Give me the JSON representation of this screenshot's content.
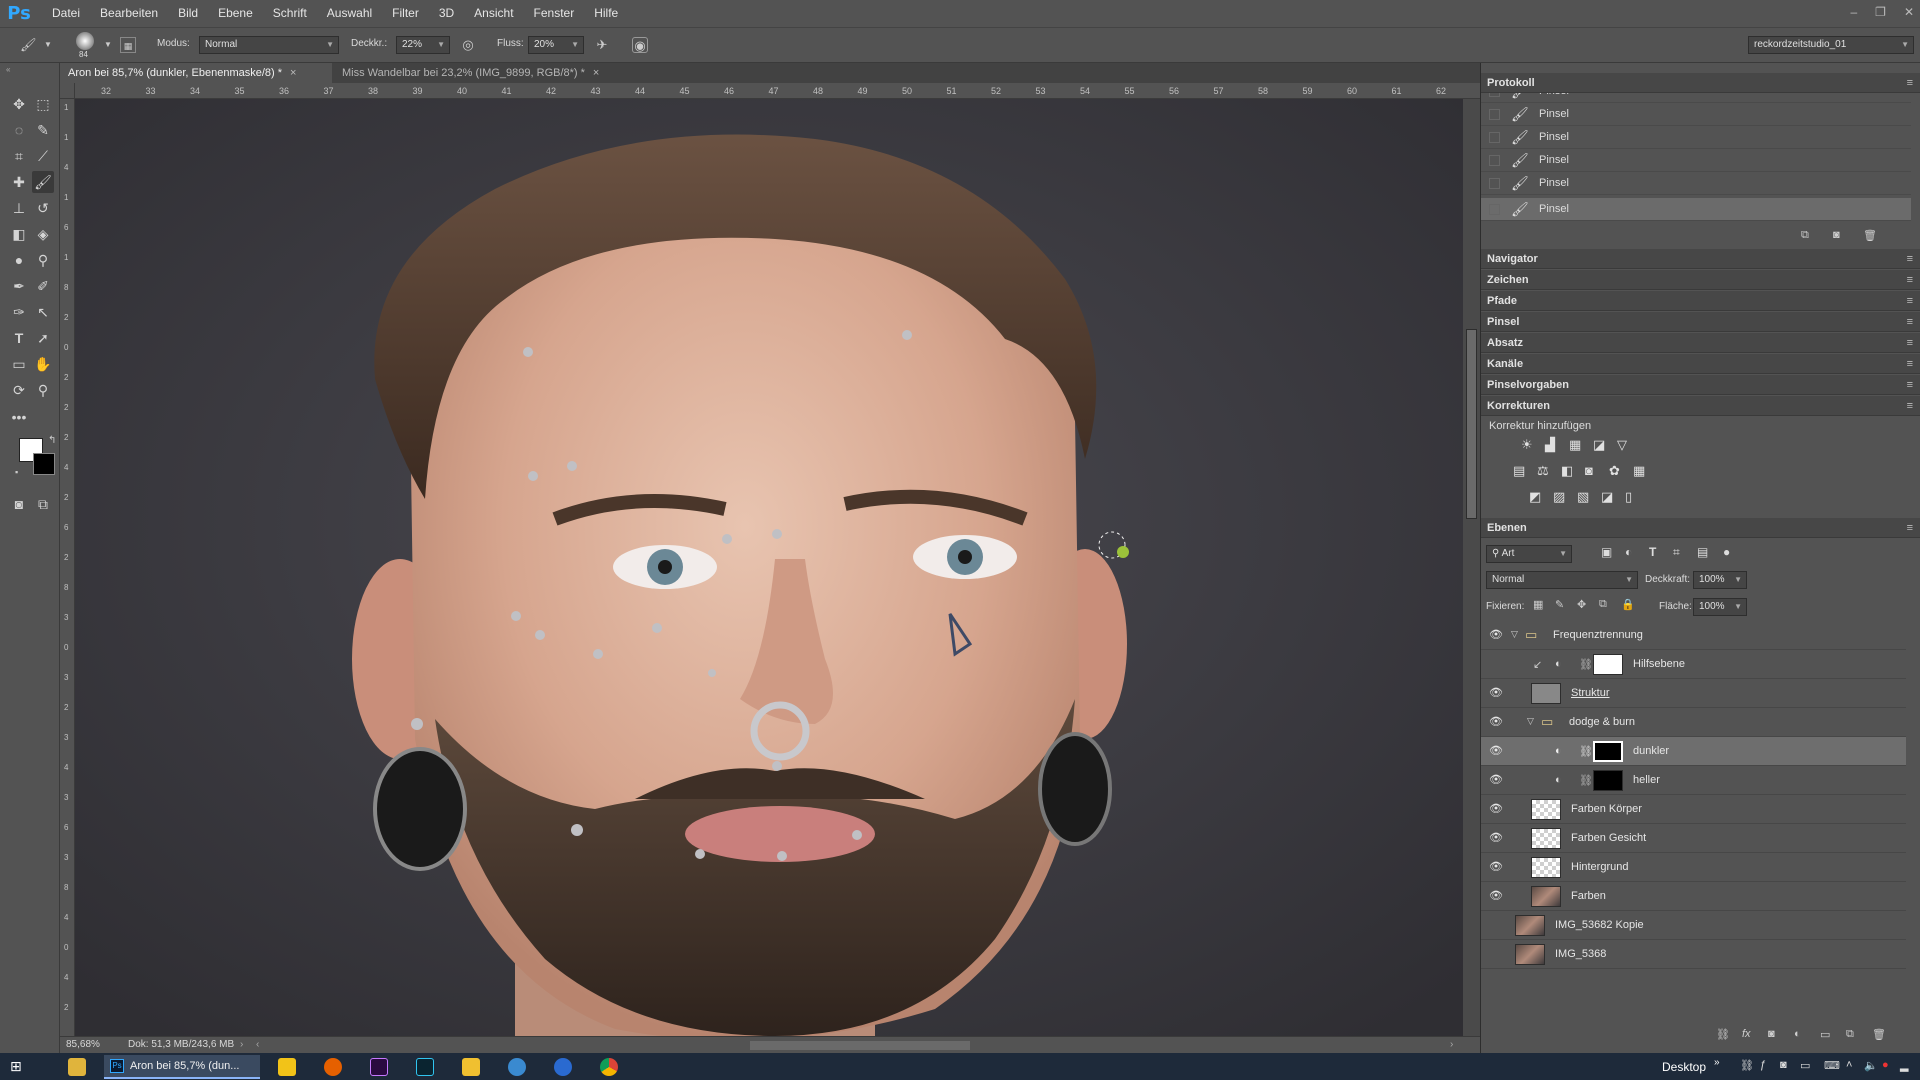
{
  "menubar": {
    "logo": "Ps",
    "items": [
      "Datei",
      "Bearbeiten",
      "Bild",
      "Ebene",
      "Schrift",
      "Auswahl",
      "Filter",
      "3D",
      "Ansicht",
      "Fenster",
      "Hilfe"
    ],
    "window_controls": [
      "–",
      "❐",
      "✕"
    ]
  },
  "options": {
    "brush_size": "84",
    "mode_label": "Modus:",
    "mode_value": "Normal",
    "opacity_label": "Deckkr.:",
    "opacity_value": "22%",
    "flow_label": "Fluss:",
    "flow_value": "20%",
    "workspace": "reckordzeitstudio_01"
  },
  "tabs": [
    {
      "label": "Aron bei 85,7% (dunkler, Ebenenmaske/8) *",
      "close": "×"
    },
    {
      "label": "Miss Wandelbar bei 23,2% (IMG_9899, RGB/8*) *",
      "close": "×"
    }
  ],
  "ruler_top": [
    "32",
    "33",
    "34",
    "35",
    "36",
    "37",
    "38",
    "39",
    "40",
    "41",
    "42",
    "43",
    "44",
    "45",
    "46",
    "47",
    "48",
    "49",
    "50",
    "51",
    "52",
    "53",
    "54",
    "55",
    "56",
    "57",
    "58",
    "59",
    "60",
    "61",
    "62"
  ],
  "ruler_left": [
    "1",
    "1",
    "4",
    "1",
    "6",
    "1",
    "8",
    "2",
    "0",
    "2",
    "2",
    "2",
    "4",
    "2",
    "6",
    "2",
    "8",
    "3",
    "0",
    "3",
    "2",
    "3",
    "4",
    "3",
    "6",
    "3",
    "8",
    "4",
    "0",
    "4",
    "2"
  ],
  "status": {
    "zoom": "85,68%",
    "doc": "Dok: 51,3 MB/243,6 MB"
  },
  "panels": {
    "protokoll_title": "Protokoll",
    "history": [
      "Pinsel",
      "Pinsel",
      "Pinsel",
      "Pinsel",
      "Pinsel",
      "Pinsel"
    ],
    "collapsed": [
      "Navigator",
      "Zeichen",
      "Pfade",
      "Pinsel",
      "Absatz",
      "Kanäle",
      "Pinselvorgaben",
      "Korrekturen"
    ],
    "korrektur_add": "Korrektur hinzufügen",
    "ebenen_title": "Ebenen",
    "filter_kind": "Art",
    "blend_mode": "Normal",
    "opacity_label": "Deckkraft:",
    "opacity_value": "100%",
    "lock_label": "Fixieren:",
    "fill_label": "Fläche:",
    "fill_value": "100%",
    "menu_glyph": "≡"
  },
  "layers": [
    {
      "name": "Frequenztrennung",
      "type": "group",
      "visible": true
    },
    {
      "name": "Hilfsebene",
      "type": "adjustment",
      "visible": false
    },
    {
      "name": "Struktur",
      "type": "pixel",
      "visible": true
    },
    {
      "name": "dodge & burn",
      "type": "group",
      "visible": true
    },
    {
      "name": "dunkler",
      "type": "adjustment",
      "visible": true,
      "selected": true
    },
    {
      "name": "heller",
      "type": "adjustment",
      "visible": true
    },
    {
      "name": "Farben Körper",
      "type": "pixel",
      "visible": true
    },
    {
      "name": "Farben Gesicht",
      "type": "pixel",
      "visible": true
    },
    {
      "name": "Hintergrund",
      "type": "pixel",
      "visible": true
    },
    {
      "name": "Farben",
      "type": "pixel",
      "visible": true
    },
    {
      "name": "IMG_53682 Kopie",
      "type": "photo",
      "visible": false
    },
    {
      "name": "IMG_5368",
      "type": "photo",
      "visible": false
    }
  ],
  "taskbar": {
    "active_app": "Aron bei 85,7% (dun...",
    "desktop_label": "Desktop"
  }
}
